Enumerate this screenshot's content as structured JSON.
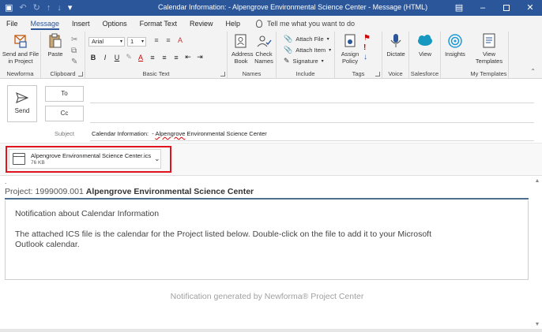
{
  "window": {
    "title": "Calendar Information:  - Alpengrove Environmental Science Center  -  Message (HTML)"
  },
  "menu_tabs": [
    "File",
    "Message",
    "Insert",
    "Options",
    "Format Text",
    "Review",
    "Help"
  ],
  "active_tab": "Message",
  "tell_me": "Tell me what you want to do",
  "ribbon": {
    "send_file_project": "Send and File in Project",
    "newforma_label": "Newforma",
    "paste": "Paste",
    "clipboard_label": "Clipboard",
    "font_name": "Arial",
    "font_size": "1",
    "basic_text_label": "Basic Text",
    "address_book": "Address Book",
    "check_names": "Check Names",
    "names_label": "Names",
    "attach_file": "Attach File",
    "attach_item": "Attach Item",
    "signature": "Signature",
    "include_label": "Include",
    "assign_policy": "Assign Policy",
    "tags_label": "Tags",
    "dictate": "Dictate",
    "voice_label": "Voice",
    "view": "View",
    "salesforce_label": "Salesforce",
    "insights": "Insights",
    "view_templates": "View Templates",
    "my_templates_label": "My Templates"
  },
  "compose": {
    "send": "Send",
    "to": "To",
    "cc": "Cc",
    "subject_label": "Subject",
    "subject_prefix": "Calendar Information:  - ",
    "subject_misspelled": "Alpengrove",
    "subject_rest": " Environmental Science Center"
  },
  "attachment": {
    "name": "Alpengrove Environmental Science Center.ics",
    "size": "76 KB"
  },
  "message": {
    "dot": ".",
    "project_prefix": "Project: 1999009.001 ",
    "project_name": "Alpengrove Environmental Science Center",
    "notice_title": "Notification about Calendar Information",
    "notice_body": "The attached ICS file is the calendar for the Project listed below. Double-click on the file to add it to your Microsoft Outlook calendar.",
    "footer": "Notification generated by Newforma® Project Center"
  },
  "colors": {
    "title_bar": "#2b579a",
    "highlight": "#e0141e",
    "project_rule": "#4f6f8f"
  }
}
